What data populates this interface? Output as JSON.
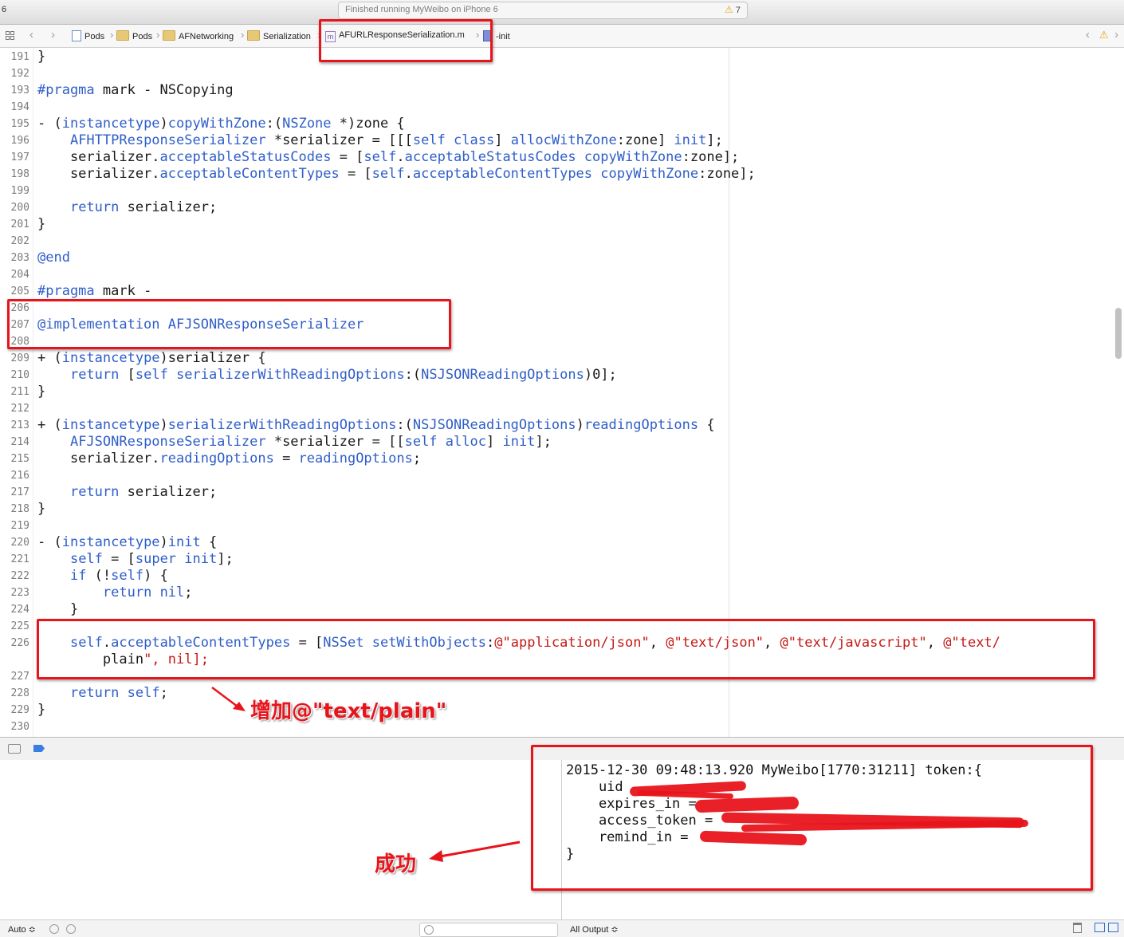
{
  "topbar": {
    "left_num": "6",
    "activity_text": "Finished running MyWeibo on iPhone 6",
    "warning_count": "7"
  },
  "jumpbar": {
    "crumbs": [
      "Pods",
      "Pods",
      "AFNetworking",
      "Serialization",
      "AFURLResponseSerialization.m",
      "-init"
    ]
  },
  "editor": {
    "lines": [
      {
        "no": "191",
        "code": "}"
      },
      {
        "no": "192",
        "code": ""
      },
      {
        "no": "193",
        "code": "#pragma mark - NSCopying"
      },
      {
        "no": "194",
        "code": ""
      },
      {
        "no": "195",
        "code": "- (instancetype)copyWithZone:(NSZone *)zone {"
      },
      {
        "no": "196",
        "code": "    AFHTTPResponseSerializer *serializer = [[[self class] allocWithZone:zone] init];"
      },
      {
        "no": "197",
        "code": "    serializer.acceptableStatusCodes = [self.acceptableStatusCodes copyWithZone:zone];"
      },
      {
        "no": "198",
        "code": "    serializer.acceptableContentTypes = [self.acceptableContentTypes copyWithZone:zone];"
      },
      {
        "no": "199",
        "code": ""
      },
      {
        "no": "200",
        "code": "    return serializer;"
      },
      {
        "no": "201",
        "code": "}"
      },
      {
        "no": "202",
        "code": ""
      },
      {
        "no": "203",
        "code": "@end"
      },
      {
        "no": "204",
        "code": ""
      },
      {
        "no": "205",
        "code": "#pragma mark -"
      },
      {
        "no": "206",
        "code": ""
      },
      {
        "no": "207",
        "code": "@implementation AFJSONResponseSerializer"
      },
      {
        "no": "208",
        "code": ""
      },
      {
        "no": "209",
        "code": "+ (instancetype)serializer {"
      },
      {
        "no": "210",
        "code": "    return [self serializerWithReadingOptions:(NSJSONReadingOptions)0];"
      },
      {
        "no": "211",
        "code": "}"
      },
      {
        "no": "212",
        "code": ""
      },
      {
        "no": "213",
        "code": "+ (instancetype)serializerWithReadingOptions:(NSJSONReadingOptions)readingOptions {"
      },
      {
        "no": "214",
        "code": "    AFJSONResponseSerializer *serializer = [[self alloc] init];"
      },
      {
        "no": "215",
        "code": "    serializer.readingOptions = readingOptions;"
      },
      {
        "no": "216",
        "code": ""
      },
      {
        "no": "217",
        "code": "    return serializer;"
      },
      {
        "no": "218",
        "code": "}"
      },
      {
        "no": "219",
        "code": ""
      },
      {
        "no": "220",
        "code": "- (instancetype)init {"
      },
      {
        "no": "221",
        "code": "    self = [super init];"
      },
      {
        "no": "222",
        "code": "    if (!self) {"
      },
      {
        "no": "223",
        "code": "        return nil;"
      },
      {
        "no": "224",
        "code": "    }"
      },
      {
        "no": "225",
        "code": ""
      },
      {
        "no": "226",
        "code": "    self.acceptableContentTypes = [NSSet setWithObjects:@\"application/json\", @\"text/json\", @\"text/javascript\", @\"text/"
      },
      {
        "no": "",
        "code": "        plain\", nil];"
      },
      {
        "no": "227",
        "code": ""
      },
      {
        "no": "228",
        "code": "    return self;"
      },
      {
        "no": "229",
        "code": "}"
      },
      {
        "no": "230",
        "code": ""
      }
    ]
  },
  "annotations": {
    "added_text": "增加@\"text/plain\"",
    "success_text": "成功"
  },
  "console": {
    "lines": [
      "2015-12-30 09:48:13.920 MyWeibo[1770:31211] token:{",
      "    uid",
      "    expires_in = ",
      "    access_token = ",
      "    remind_in = ",
      "}"
    ]
  },
  "bottombar": {
    "auto_label": "Auto ≎",
    "output_label": "All Output ≎"
  },
  "colors": {
    "annotation_red": "#e8141b",
    "keyword_blue": "#2f5ec8",
    "string_red": "#c41a16"
  }
}
